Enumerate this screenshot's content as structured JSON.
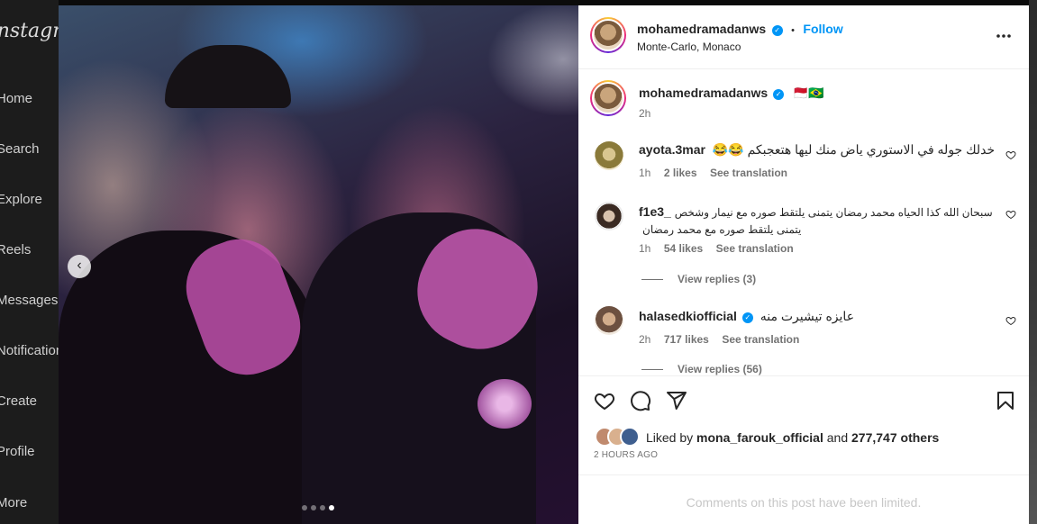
{
  "sidebar": {
    "logo": "Instagram",
    "items": [
      "Home",
      "Search",
      "Explore",
      "Reels",
      "Messages",
      "Notifications",
      "Create",
      "Profile",
      "More"
    ]
  },
  "post": {
    "username": "mohamedramadanws",
    "follow_label": "Follow",
    "separator": "•",
    "location": "Monte-Carlo, Monaco",
    "more_icon": "more-horizontal-icon",
    "caption": {
      "username": "mohamedramadanws",
      "text": "🇲🇨🇧🇷",
      "time": "2h"
    },
    "carousel": {
      "total": 4,
      "active": 4,
      "prev_icon": "chevron-left-icon"
    }
  },
  "comments": [
    {
      "username": "ayota.3mar",
      "text": "خدلك جوله في الاستوري ياض منك ليها هتعجبكم 😂😂",
      "time": "1h",
      "likes": "2 likes",
      "translate": "See translation"
    },
    {
      "username": "f1e3_",
      "text": "سبحان الله كذا الحياه محمد رمضان يتمنى يلتقط صوره مع نيمار وشخص يتمنى يلتقط صوره مع محمد رمضان",
      "time": "1h",
      "likes": "54 likes",
      "translate": "See translation",
      "replies": "View replies (3)"
    },
    {
      "username": "halasedkiofficial",
      "text": "عايزه تيشيرت منه",
      "time": "2h",
      "likes": "717 likes",
      "translate": "See translation",
      "replies": "View replies (56)"
    }
  ],
  "actions": {
    "like_icon": "heart-icon",
    "comment_icon": "comment-icon",
    "share_icon": "share-icon",
    "save_icon": "bookmark-icon"
  },
  "likes": {
    "prefix": "Liked by",
    "user": "mona_farouk_official",
    "and": "and",
    "others": "277,747 others"
  },
  "timestamp": "2 HOURS AGO",
  "comments_limited": "Comments on this post have been limited.",
  "colors": {
    "accent": "#0095f6",
    "text": "#262626",
    "muted": "#737373",
    "disabled": "#c7c7c7"
  }
}
